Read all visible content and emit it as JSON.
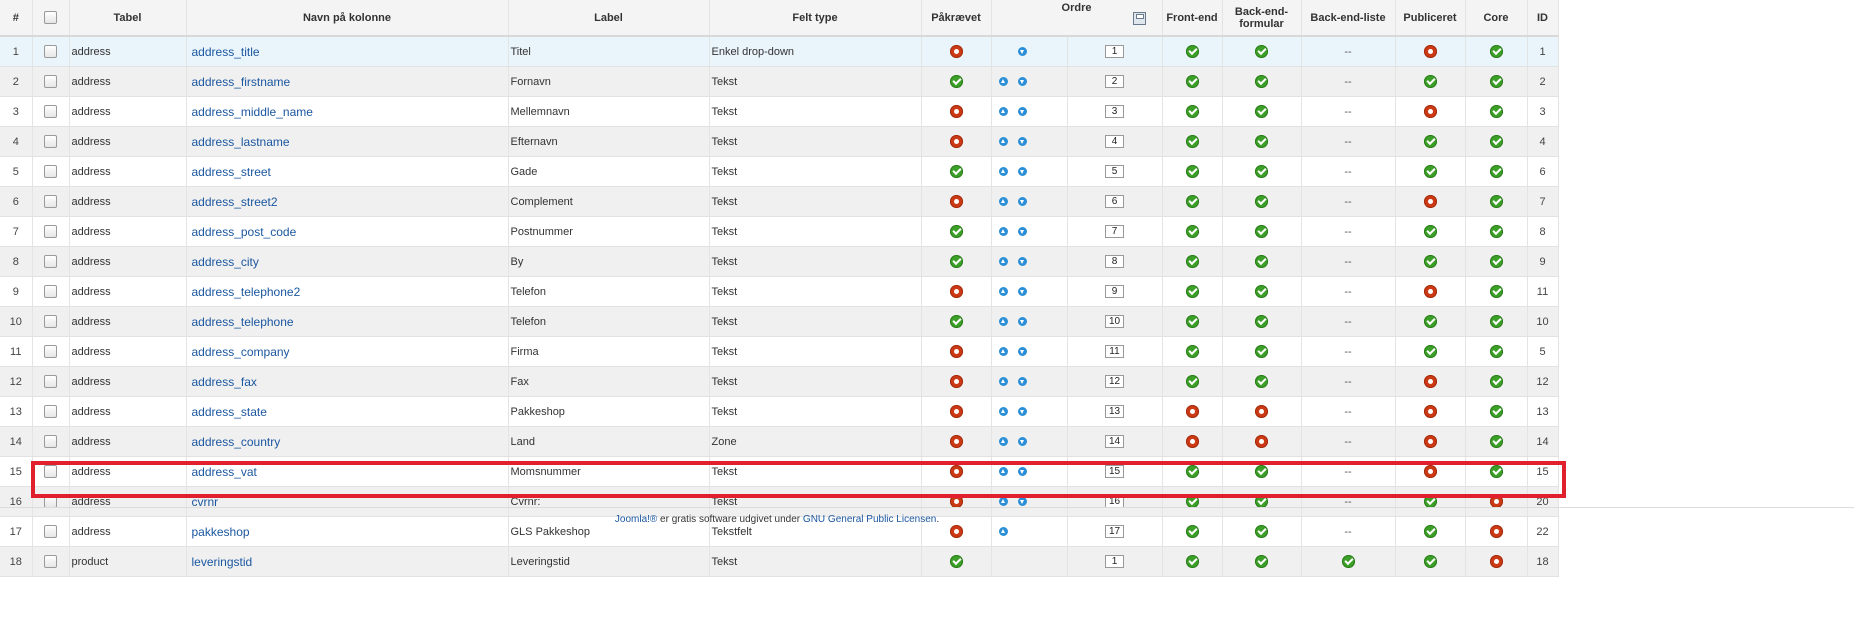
{
  "headers": {
    "num": "#",
    "table": "Tabel",
    "column_name": "Navn på kolonne",
    "label": "Label",
    "field_type": "Felt type",
    "required": "Påkrævet",
    "ordre": "Ordre",
    "frontend": "Front-end",
    "backend_form": "Back-end-formular",
    "backend_list": "Back-end-liste",
    "published": "Publiceret",
    "core": "Core",
    "id": "ID"
  },
  "rows": [
    {
      "num": "1",
      "table": "address",
      "name": "address_title",
      "label": "Titel",
      "type": "Enkel drop-down",
      "required": "red",
      "up": false,
      "down": true,
      "order": "1",
      "frontend": "green",
      "backend_form": "green",
      "backend_list": "--",
      "published": "red",
      "core": "green",
      "id": "1"
    },
    {
      "num": "2",
      "table": "address",
      "name": "address_firstname",
      "label": "Fornavn",
      "type": "Tekst",
      "required": "green",
      "up": true,
      "down": true,
      "order": "2",
      "frontend": "green",
      "backend_form": "green",
      "backend_list": "--",
      "published": "green",
      "core": "green",
      "id": "2"
    },
    {
      "num": "3",
      "table": "address",
      "name": "address_middle_name",
      "label": "Mellemnavn",
      "type": "Tekst",
      "required": "red",
      "up": true,
      "down": true,
      "order": "3",
      "frontend": "green",
      "backend_form": "green",
      "backend_list": "--",
      "published": "red",
      "core": "green",
      "id": "3"
    },
    {
      "num": "4",
      "table": "address",
      "name": "address_lastname",
      "label": "Efternavn",
      "type": "Tekst",
      "required": "red",
      "up": true,
      "down": true,
      "order": "4",
      "frontend": "green",
      "backend_form": "green",
      "backend_list": "--",
      "published": "green",
      "core": "green",
      "id": "4"
    },
    {
      "num": "5",
      "table": "address",
      "name": "address_street",
      "label": "Gade",
      "type": "Tekst",
      "required": "green",
      "up": true,
      "down": true,
      "order": "5",
      "frontend": "green",
      "backend_form": "green",
      "backend_list": "--",
      "published": "green",
      "core": "green",
      "id": "6"
    },
    {
      "num": "6",
      "table": "address",
      "name": "address_street2",
      "label": "Complement",
      "type": "Tekst",
      "required": "red",
      "up": true,
      "down": true,
      "order": "6",
      "frontend": "green",
      "backend_form": "green",
      "backend_list": "--",
      "published": "red",
      "core": "green",
      "id": "7"
    },
    {
      "num": "7",
      "table": "address",
      "name": "address_post_code",
      "label": "Postnummer",
      "type": "Tekst",
      "required": "green",
      "up": true,
      "down": true,
      "order": "7",
      "frontend": "green",
      "backend_form": "green",
      "backend_list": "--",
      "published": "green",
      "core": "green",
      "id": "8"
    },
    {
      "num": "8",
      "table": "address",
      "name": "address_city",
      "label": "By",
      "type": "Tekst",
      "required": "green",
      "up": true,
      "down": true,
      "order": "8",
      "frontend": "green",
      "backend_form": "green",
      "backend_list": "--",
      "published": "green",
      "core": "green",
      "id": "9"
    },
    {
      "num": "9",
      "table": "address",
      "name": "address_telephone2",
      "label": "Telefon",
      "type": "Tekst",
      "required": "red",
      "up": true,
      "down": true,
      "order": "9",
      "frontend": "green",
      "backend_form": "green",
      "backend_list": "--",
      "published": "red",
      "core": "green",
      "id": "11"
    },
    {
      "num": "10",
      "table": "address",
      "name": "address_telephone",
      "label": "Telefon",
      "type": "Tekst",
      "required": "green",
      "up": true,
      "down": true,
      "order": "10",
      "frontend": "green",
      "backend_form": "green",
      "backend_list": "--",
      "published": "green",
      "core": "green",
      "id": "10"
    },
    {
      "num": "11",
      "table": "address",
      "name": "address_company",
      "label": "Firma",
      "type": "Tekst",
      "required": "red",
      "up": true,
      "down": true,
      "order": "11",
      "frontend": "green",
      "backend_form": "green",
      "backend_list": "--",
      "published": "green",
      "core": "green",
      "id": "5"
    },
    {
      "num": "12",
      "table": "address",
      "name": "address_fax",
      "label": "Fax",
      "type": "Tekst",
      "required": "red",
      "up": true,
      "down": true,
      "order": "12",
      "frontend": "green",
      "backend_form": "green",
      "backend_list": "--",
      "published": "red",
      "core": "green",
      "id": "12"
    },
    {
      "num": "13",
      "table": "address",
      "name": "address_state",
      "label": "Pakkeshop",
      "type": "Tekst",
      "required": "red",
      "up": true,
      "down": true,
      "order": "13",
      "frontend": "red",
      "backend_form": "red",
      "backend_list": "--",
      "published": "red",
      "core": "green",
      "id": "13"
    },
    {
      "num": "14",
      "table": "address",
      "name": "address_country",
      "label": "Land",
      "type": "Zone",
      "required": "red",
      "up": true,
      "down": true,
      "order": "14",
      "frontend": "red",
      "backend_form": "red",
      "backend_list": "--",
      "published": "red",
      "core": "green",
      "id": "14"
    },
    {
      "num": "15",
      "table": "address",
      "name": "address_vat",
      "label": "Momsnummer",
      "type": "Tekst",
      "required": "red",
      "up": true,
      "down": true,
      "order": "15",
      "frontend": "green",
      "backend_form": "green",
      "backend_list": "--",
      "published": "red",
      "core": "green",
      "id": "15"
    },
    {
      "num": "16",
      "table": "address",
      "name": "cvrnr",
      "label": "Cvrnr:",
      "type": "Tekst",
      "required": "red",
      "up": true,
      "down": true,
      "order": "16",
      "frontend": "green",
      "backend_form": "green",
      "backend_list": "--",
      "published": "green",
      "core": "red",
      "id": "20"
    },
    {
      "num": "17",
      "table": "address",
      "name": "pakkeshop",
      "label": "GLS Pakkeshop",
      "type": "Tekstfelt",
      "required": "red",
      "up": true,
      "down": false,
      "order": "17",
      "frontend": "green",
      "backend_form": "green",
      "backend_list": "--",
      "published": "green",
      "core": "red",
      "id": "22"
    },
    {
      "num": "18",
      "table": "product",
      "name": "leveringstid",
      "label": "Leveringstid",
      "type": "Tekst",
      "required": "green",
      "up": false,
      "down": false,
      "order": "1",
      "frontend": "green",
      "backend_form": "green",
      "backend_list": "green",
      "published": "green",
      "core": "red",
      "id": "18"
    }
  ],
  "footer": {
    "joomla_link": "Joomla!®",
    "text": " er gratis software udgivet under ",
    "license_link": "GNU General Public Licensen",
    "end": "."
  },
  "colors": {
    "accent_link": "#1b57a0",
    "status_green": "#3c9f28",
    "status_red": "#cc3a15",
    "highlight": "#e0202d"
  }
}
